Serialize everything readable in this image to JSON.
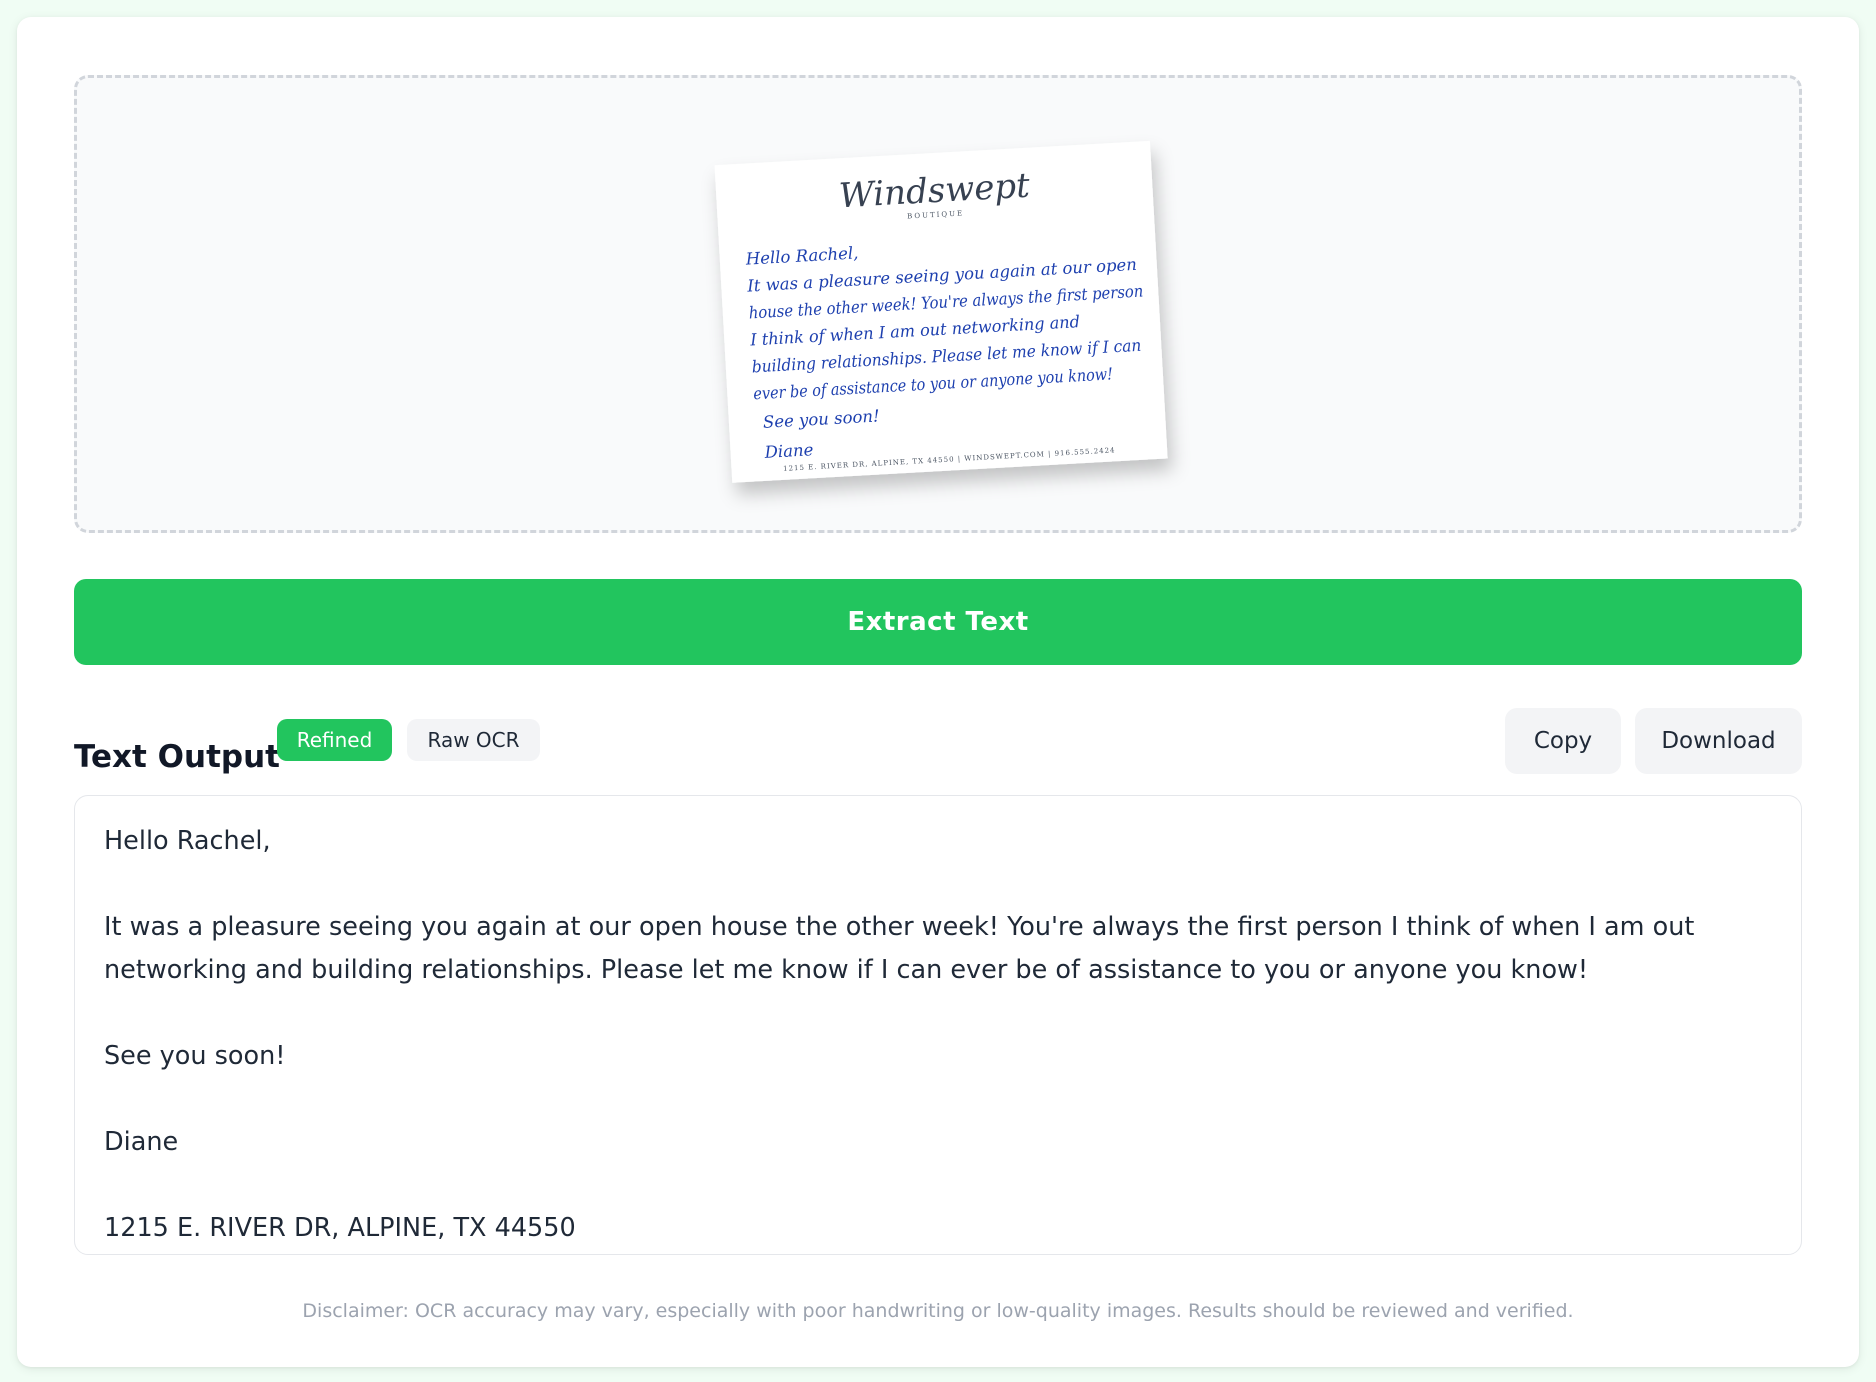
{
  "upload": {
    "note_image": {
      "logo": "Windswept",
      "logo_sub": "BOUTIQUE",
      "handwriting": [
        "Hello Rachel,",
        "It was a pleasure seeing you again at our open",
        "house the other week! You're always the first person",
        "I think of when I am out networking and",
        "building relationships. Please let me know if I can",
        "ever be of assistance to you or anyone you know!",
        "See you soon!",
        "Diane"
      ],
      "footer": "1215 E. RIVER DR, ALPINE, TX 44550  |  WINDSWEPT.COM  |  916.555.2424"
    }
  },
  "extract_button_label": "Extract Text",
  "output": {
    "title": "Text Output",
    "tabs": [
      {
        "label": "Refined",
        "active": true
      },
      {
        "label": "Raw OCR",
        "active": false
      }
    ],
    "copy_label": "Copy",
    "download_label": "Download",
    "text": {
      "greeting": "Hello Rachel,",
      "body": "It was a pleasure seeing you again at our open house the other week! You're always the first person I think of when I am out networking and building relationships. Please let me know if I can ever be of assistance to you or anyone you know!",
      "closing": "See you soon!",
      "signature": "Diane",
      "address": "1215 E. RIVER DR, ALPINE, TX 44550"
    }
  },
  "disclaimer": "Disclaimer: OCR accuracy may vary, especially with poor handwriting or low-quality images. Results should be reviewed and verified.",
  "colors": {
    "accent": "#22c55e",
    "page_background": "#f0fdf4",
    "handwriting_ink": "#1e40af"
  }
}
